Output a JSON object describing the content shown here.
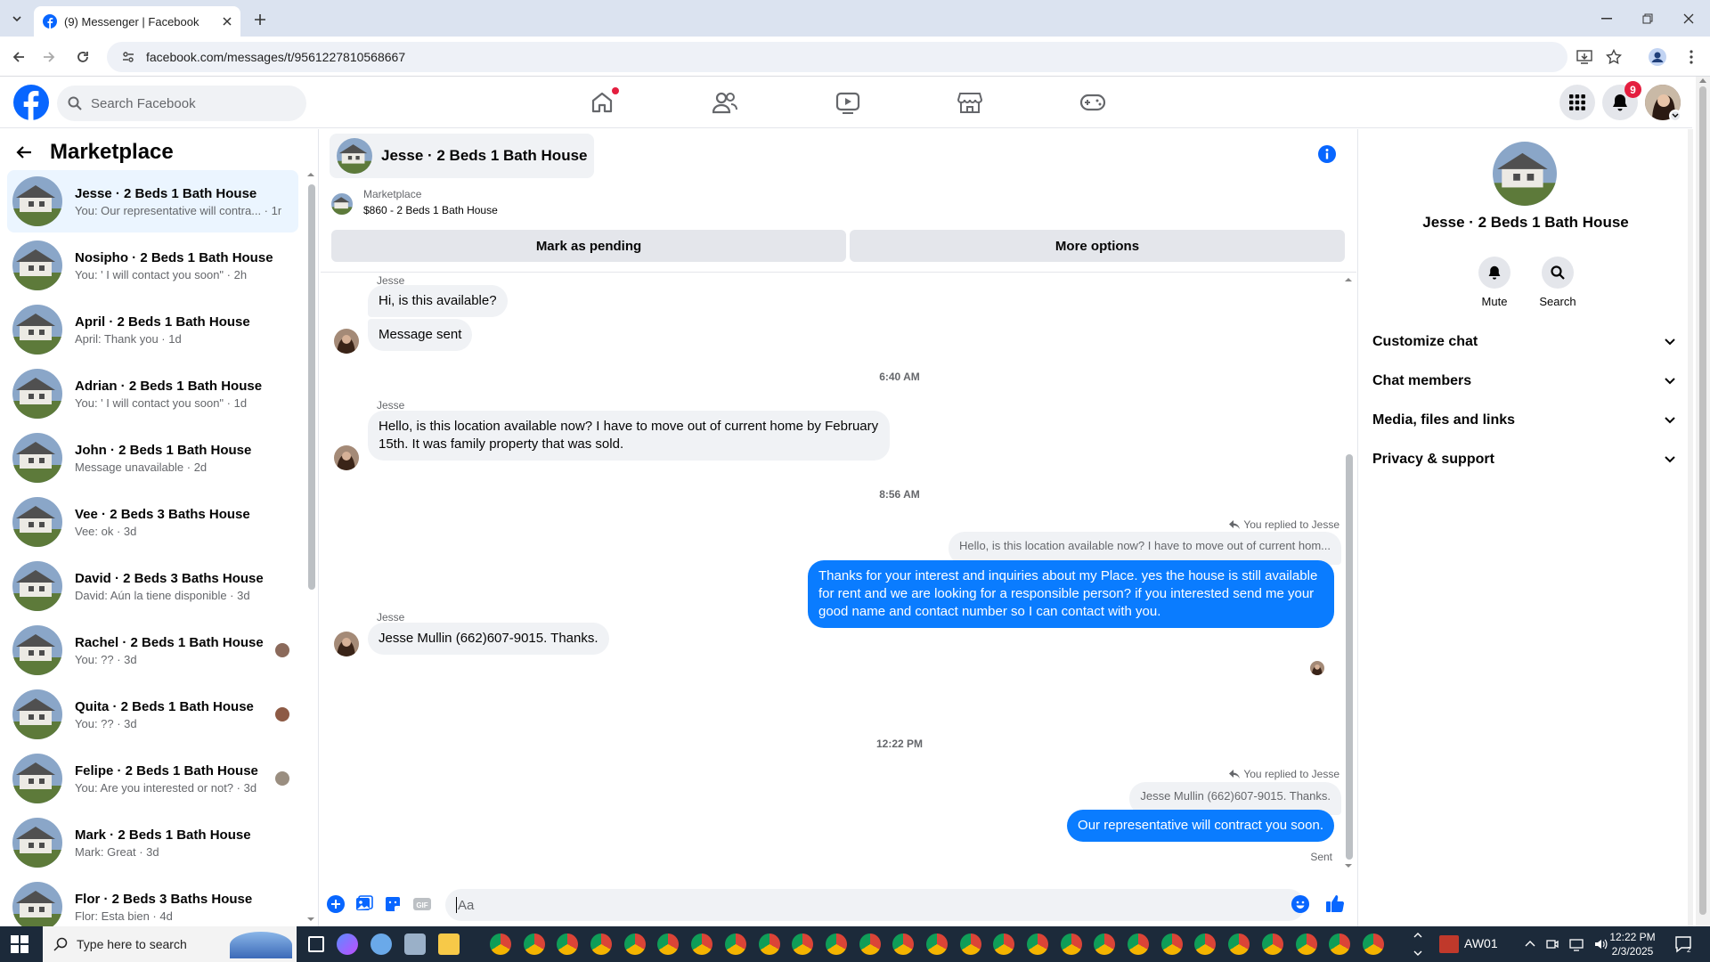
{
  "browser": {
    "tab_title": "(9) Messenger | Facebook",
    "url": "facebook.com/messages/t/9561227810568667"
  },
  "header": {
    "search_placeholder": "Search Facebook",
    "notification_count": "9"
  },
  "sidebar": {
    "title": "Marketplace",
    "conversations": [
      {
        "name": "Jesse · 2 Beds 1 Bath House",
        "preview": "You: Our representative will contra... · 1m",
        "active": true
      },
      {
        "name": "Nosipho · 2 Beds 1 Bath House",
        "preview": "You: ' I will contact you soon\" · 2h"
      },
      {
        "name": "April · 2 Beds 1 Bath House",
        "preview": "April: Thank you · 1d"
      },
      {
        "name": "Adrian · 2 Beds 1 Bath House",
        "preview": "You: ' I will contact you soon\" · 1d"
      },
      {
        "name": "John · 2 Beds 1 Bath House",
        "preview": "Message unavailable · 2d"
      },
      {
        "name": "Vee · 2 Beds 3 Baths House",
        "preview": "Vee: ok · 3d"
      },
      {
        "name": "David · 2 Beds 3 Baths House",
        "preview": "David: Aún la tiene disponible · 3d"
      },
      {
        "name": "Rachel · 2 Beds 1 Bath House",
        "preview": "You: ?? · 3d"
      },
      {
        "name": "Quita · 2 Beds 1 Bath House",
        "preview": "You: ?? · 3d"
      },
      {
        "name": "Felipe · 2 Beds 1 Bath House",
        "preview": "You: Are you interested or not? · 3d"
      },
      {
        "name": "Mark · 2 Beds 1 Bath House",
        "preview": "Mark: Great · 3d"
      },
      {
        "name": "Flor · 2 Beds 3 Baths House",
        "preview": "Flor: Esta bien · 4d"
      }
    ]
  },
  "chat": {
    "title": "Jesse · 2 Beds 1 Bath House",
    "marketplace_label": "Marketplace",
    "listing": "$860 - 2 Beds 1 Bath House",
    "mark_pending": "Mark as pending",
    "more_options": "More options",
    "messages": {
      "sender": "Jesse",
      "m1": "Hi, is this available?",
      "m2": "Message sent",
      "t1": "6:40 AM",
      "m3": "Hello, is this location available now? I have to move out of current home by February 15th. It was family property that was sold.",
      "t2": "8:56 AM",
      "reply_label": "You replied to Jesse",
      "quote1": "Hello, is this location available now? I have to move out of current hom...",
      "out1": "Thanks for your interest and inquiries about my Place. yes the house is still available for rent and we are looking for a responsible person?  if you interested send me your good name and contact number  so I can contact with you.",
      "m4": "Jesse Mullin  (662)607-9015. Thanks.",
      "t3": "12:22 PM",
      "quote2": "Jesse Mullin  (662)607-9015. Thanks.",
      "out2": "Our representative will contract you soon.",
      "status": "Sent"
    },
    "composer_placeholder": "Aa"
  },
  "details": {
    "title": "Jesse · 2 Beds 1 Bath House",
    "mute": "Mute",
    "search": "Search",
    "sections": [
      "Customize chat",
      "Chat members",
      "Media, files and links",
      "Privacy & support"
    ]
  },
  "taskbar": {
    "search_placeholder": "Type here to search",
    "weather": "AW01",
    "time": "12:22 PM",
    "date": "2/3/2025"
  }
}
